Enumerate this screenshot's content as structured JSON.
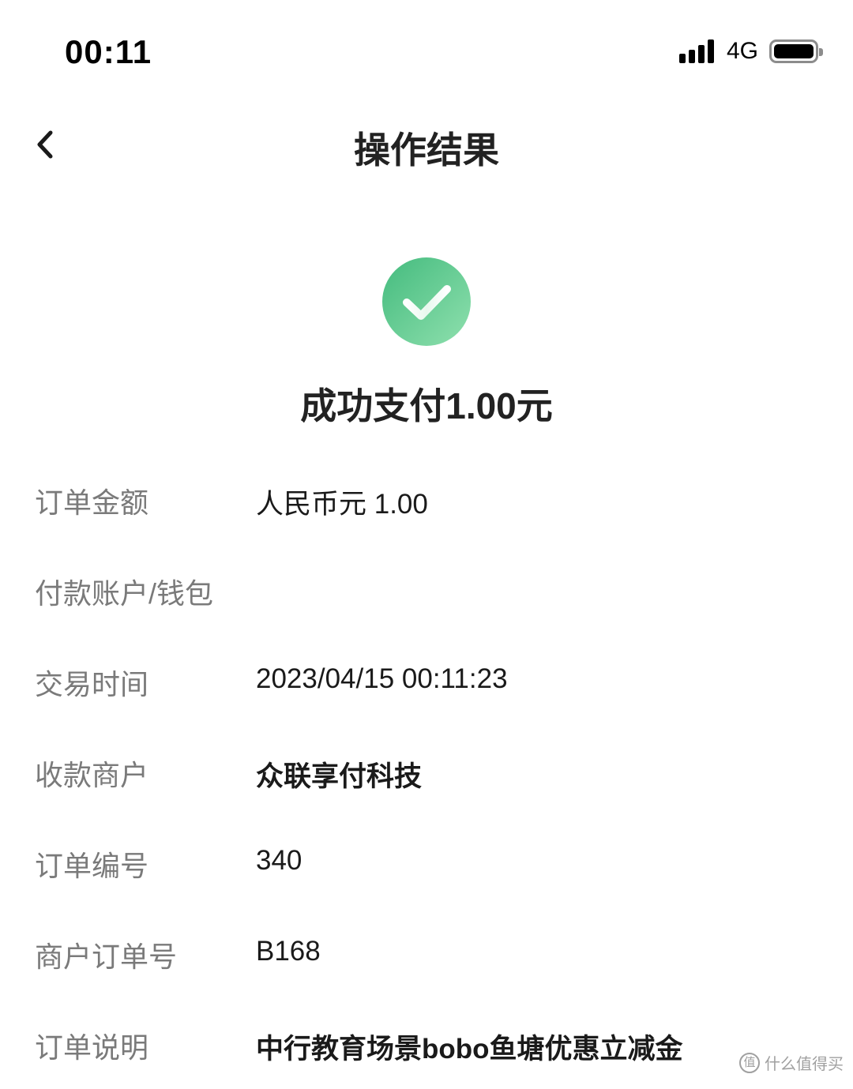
{
  "status_bar": {
    "time": "00:11",
    "network": "4G",
    "icons": [
      "signal-icon",
      "battery-icon"
    ]
  },
  "nav": {
    "back_icon": "chevron-left-icon",
    "title": "操作结果"
  },
  "result": {
    "icon": "check-circle-icon",
    "status_color": "#4cc287",
    "message": "成功支付1.00元"
  },
  "details": [
    {
      "label": "订单金额",
      "value": "人民币元 1.00"
    },
    {
      "label": "付款账户/钱包",
      "value": ""
    },
    {
      "label": "交易时间",
      "value": "2023/04/15 00:11:23"
    },
    {
      "label": "收款商户",
      "value": "众联享付科技"
    },
    {
      "label": "订单编号",
      "value": "340"
    },
    {
      "label": "商户订单号",
      "value": "B168"
    },
    {
      "label": "订单说明",
      "value": "中行教育场景bobo鱼塘优惠立减金"
    }
  ],
  "watermark": {
    "badge": "值",
    "text": "什么值得买"
  }
}
